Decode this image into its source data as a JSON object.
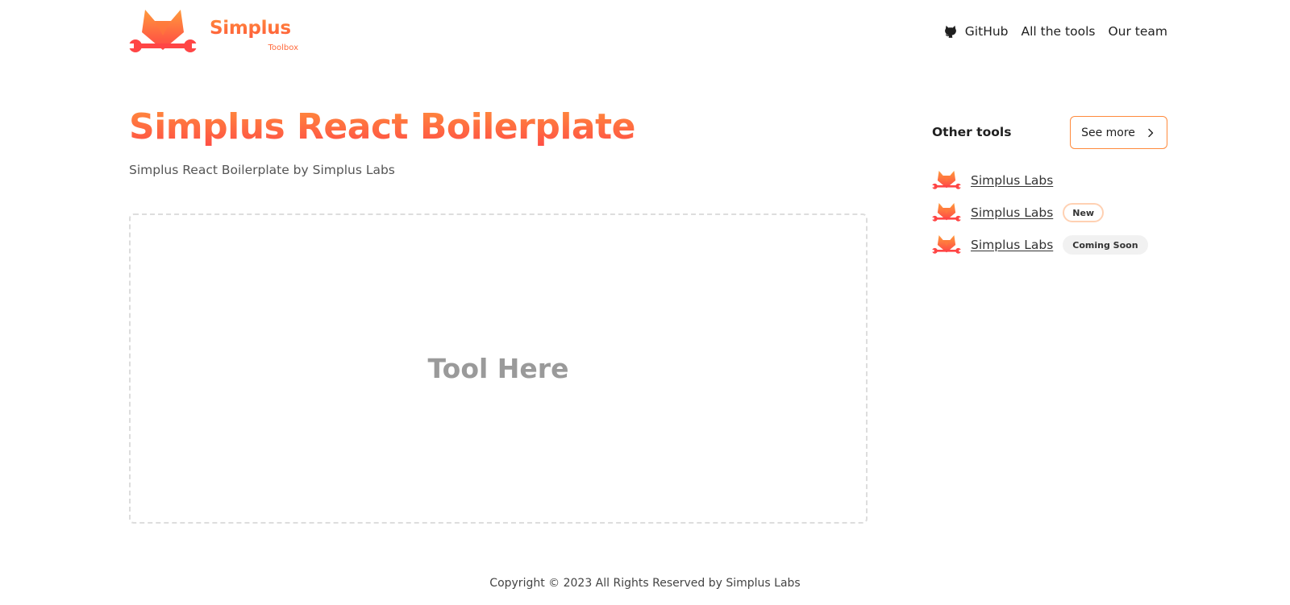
{
  "brand": {
    "name": "Simplus",
    "tagline": "Toolbox",
    "logo_icon": "fox-wrench-icon",
    "gradient_start": "#ff8a3c",
    "gradient_end": "#ff4d45"
  },
  "nav": {
    "items": [
      {
        "label": "GitHub",
        "icon": "github-icon"
      },
      {
        "label": "All the tools"
      },
      {
        "label": "Our team"
      }
    ]
  },
  "main": {
    "title": "Simplus React Boilerplate",
    "subtitle": "Simplus React Boilerplate by Simplus Labs",
    "tool_placeholder": "Tool Here"
  },
  "sidebar": {
    "title": "Other tools",
    "see_more_label": "See more",
    "tools": [
      {
        "label": "Simplus Labs",
        "badge": ""
      },
      {
        "label": "Simplus Labs",
        "badge": "New"
      },
      {
        "label": "Simplus Labs",
        "badge": "Coming Soon"
      }
    ]
  },
  "footer": {
    "copyright": "Copyright © 2023 All Rights Reserved by Simplus Labs"
  }
}
